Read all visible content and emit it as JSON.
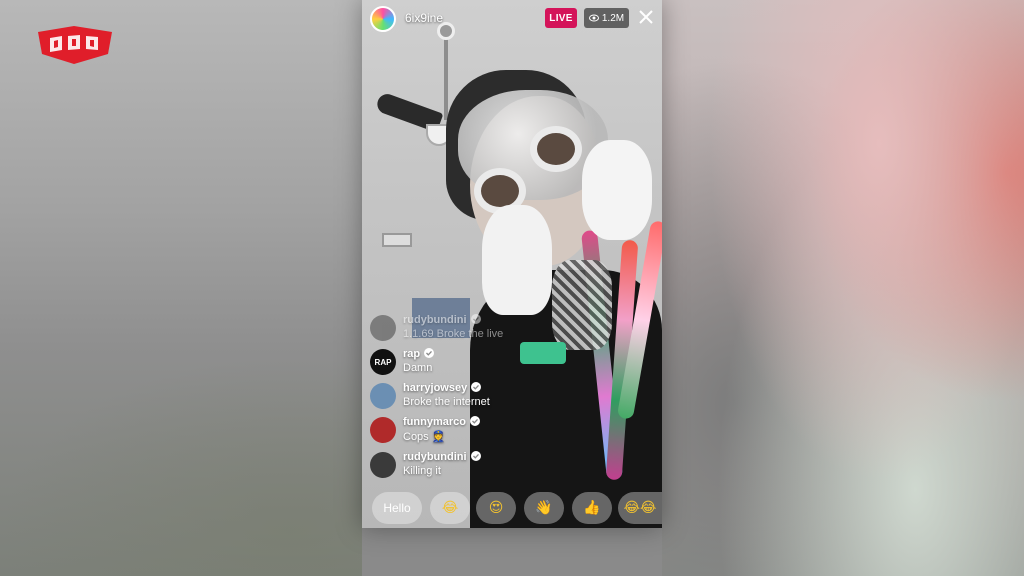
{
  "stream": {
    "host_name": "6ix9ine",
    "live_label": "LIVE",
    "viewer_count": "1.2M"
  },
  "comments": [
    {
      "user": "rudybundini",
      "message": "1.1.69 Broke the live",
      "faded": true,
      "avatar_color": "#3a3a3a"
    },
    {
      "user": "rap",
      "message": "Damn",
      "faded": false,
      "avatar_color": "#111111"
    },
    {
      "user": "harryjowsey",
      "message": "Broke the internet",
      "faded": false,
      "avatar_color": "#6b8fb3"
    },
    {
      "user": "funnymarco",
      "message": "Cops 👮",
      "faded": false,
      "avatar_color": "#b02a2a"
    },
    {
      "user": "rudybundini",
      "message": "Killing it",
      "faded": false,
      "avatar_color": "#3a3a3a"
    }
  ],
  "reactions": {
    "hello_label": "Hello",
    "emojis": [
      "😂",
      "😍",
      "👋",
      "👍",
      "😂😂"
    ]
  },
  "colors": {
    "live_badge": "#d4145a",
    "logo_red": "#e01e2a"
  }
}
